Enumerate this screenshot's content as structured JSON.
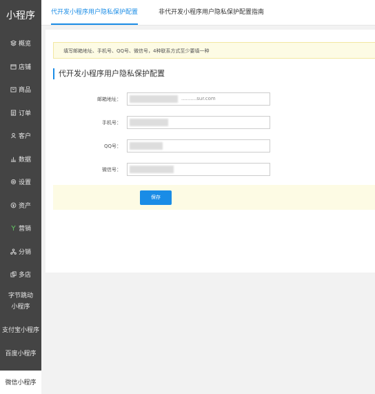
{
  "sidebar": {
    "brand": "小程序",
    "items": [
      {
        "label": "概览",
        "icon": "layers-icon"
      },
      {
        "label": "店铺",
        "icon": "store-icon"
      },
      {
        "label": "商品",
        "icon": "bag-icon"
      },
      {
        "label": "订单",
        "icon": "order-icon"
      },
      {
        "label": "客户",
        "icon": "user-icon"
      },
      {
        "label": "数据",
        "icon": "chart-icon"
      },
      {
        "label": "设置",
        "icon": "gear-icon"
      },
      {
        "label": "资产",
        "icon": "wallet-icon"
      },
      {
        "label": "营销",
        "icon": "marketing-icon"
      },
      {
        "label": "分销",
        "icon": "distribution-icon"
      },
      {
        "label": "多店",
        "icon": "multistore-icon"
      }
    ],
    "platforms": [
      {
        "label_line1": "字节跳动",
        "label_line2": "小程序"
      },
      {
        "label": "支付宝小程序"
      },
      {
        "label": "百度小程序"
      },
      {
        "label": "微信小程序"
      }
    ]
  },
  "tabs": [
    {
      "label": "代开发小程序用户隐私保护配置"
    },
    {
      "label": "非代开发小程序用户隐私保护配置指南"
    }
  ],
  "notice": "填写邮箱地址、手机号、QQ号、微信号，4种联系方式至少要填一种",
  "section_title": "代开发小程序用户隐私保护配置",
  "form": {
    "email": {
      "label": "邮箱地址：",
      "value": "..........sur.com"
    },
    "phone": {
      "label": "手机号：",
      "value": ""
    },
    "qq": {
      "label": "QQ号：",
      "value": ""
    },
    "wechat": {
      "label": "微信号：",
      "value": ""
    }
  },
  "save_label": "保存",
  "colors": {
    "accent": "#1a8ce6",
    "sidebar_bg": "#444444",
    "notice_bg": "#fdfbe4"
  }
}
